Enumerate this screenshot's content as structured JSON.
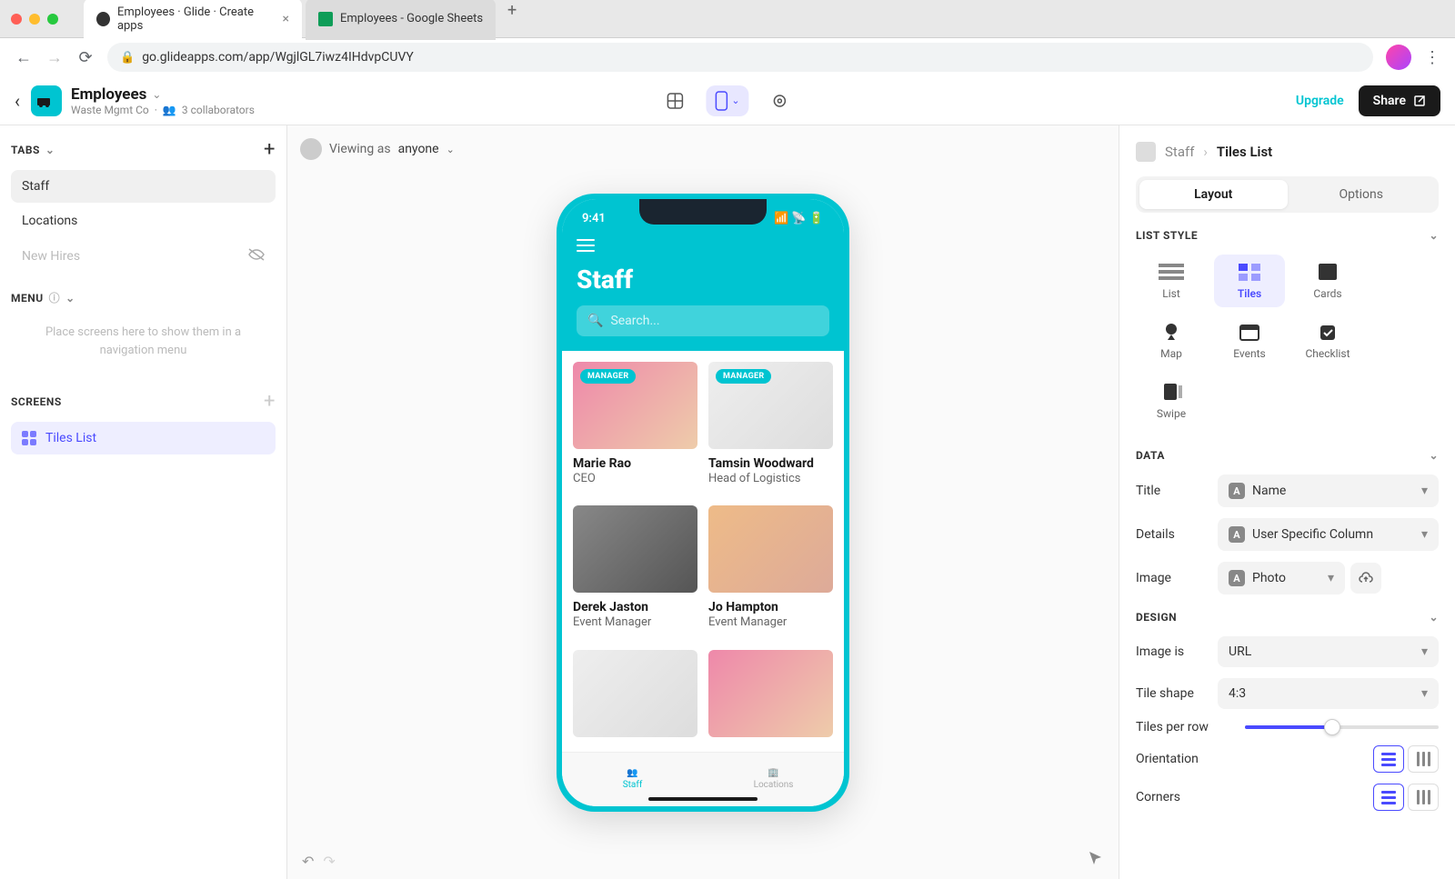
{
  "browser": {
    "tabs": [
      {
        "title": "Employees · Glide · Create apps"
      },
      {
        "title": "Employees - Google Sheets"
      }
    ],
    "url": "go.glideapps.com/app/WgjlGL7iwz4IHdvpCUVY"
  },
  "header": {
    "app_name": "Employees",
    "workspace": "Waste Mgmt Co",
    "collaborators": "3 collaborators",
    "upgrade": "Upgrade",
    "share": "Share"
  },
  "left": {
    "tabs_label": "TABS",
    "tabs": [
      "Staff",
      "Locations",
      "New Hires"
    ],
    "menu_label": "MENU",
    "menu_placeholder": "Place screens here to show them in a navigation menu",
    "screens_label": "SCREENS",
    "screens": [
      "Tiles List"
    ]
  },
  "canvas": {
    "viewing_as_label": "Viewing as",
    "viewing_as_value": "anyone"
  },
  "phone": {
    "time": "9:41",
    "title": "Staff",
    "search_placeholder": "Search...",
    "tiles": [
      {
        "badge": "MANAGER",
        "name": "Marie Rao",
        "detail": "CEO"
      },
      {
        "badge": "MANAGER",
        "name": "Tamsin Woodward",
        "detail": "Head of Logistics"
      },
      {
        "badge": "",
        "name": "Derek Jaston",
        "detail": "Event Manager"
      },
      {
        "badge": "",
        "name": "Jo Hampton",
        "detail": "Event Manager"
      }
    ],
    "tabbar": [
      "Staff",
      "Locations"
    ]
  },
  "right": {
    "breadcrumb": {
      "parent": "Staff",
      "current": "Tiles List"
    },
    "segments": [
      "Layout",
      "Options"
    ],
    "list_style_label": "LIST STYLE",
    "styles": [
      "List",
      "Tiles",
      "Cards",
      "Map",
      "Events",
      "Checklist",
      "Swipe"
    ],
    "data_label": "DATA",
    "fields": {
      "title": {
        "label": "Title",
        "value": "Name"
      },
      "details": {
        "label": "Details",
        "value": "User Specific Column"
      },
      "image": {
        "label": "Image",
        "value": "Photo"
      }
    },
    "design_label": "DESIGN",
    "design": {
      "image_is": {
        "label": "Image is",
        "value": "URL"
      },
      "tile_shape": {
        "label": "Tile shape",
        "value": "4:3"
      },
      "tiles_per_row": {
        "label": "Tiles per row"
      },
      "orientation": {
        "label": "Orientation"
      },
      "corners": {
        "label": "Corners"
      }
    }
  }
}
